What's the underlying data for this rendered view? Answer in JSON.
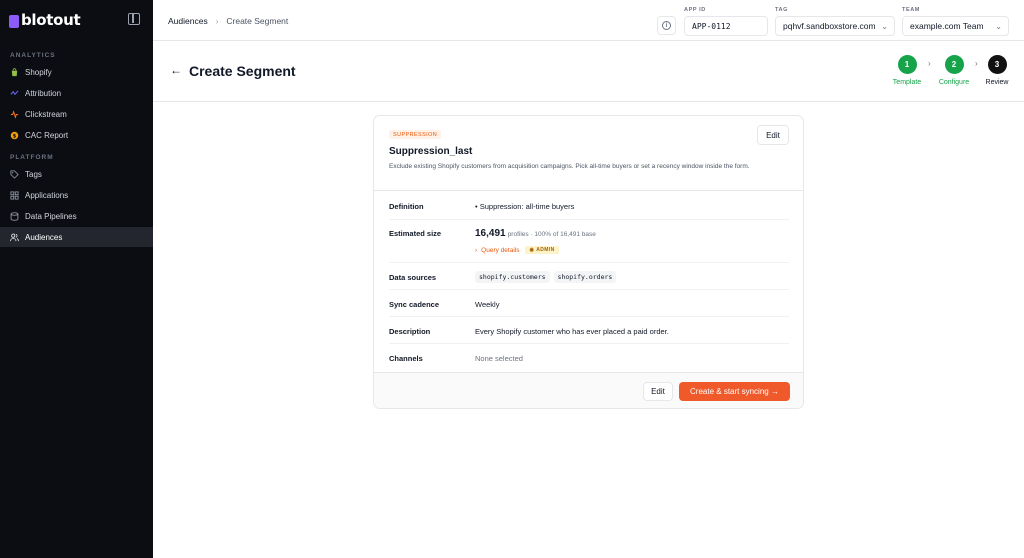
{
  "brand": {
    "name": "blotout"
  },
  "sidebar": {
    "sections": [
      {
        "label": "ANALYTICS"
      },
      {
        "label": "PLATFORM"
      }
    ],
    "items": [
      {
        "label": "Shopify",
        "icon": "shopify-bag-icon"
      },
      {
        "label": "Attribution",
        "icon": "attribution-icon"
      },
      {
        "label": "Clickstream",
        "icon": "clickstream-icon"
      },
      {
        "label": "CAC Report",
        "icon": "dollar-circle-icon"
      },
      {
        "label": "Tags",
        "icon": "tag-icon"
      },
      {
        "label": "Applications",
        "icon": "applications-icon"
      },
      {
        "label": "Data Pipelines",
        "icon": "database-icon"
      },
      {
        "label": "Audiences",
        "icon": "users-icon",
        "active": true
      }
    ]
  },
  "topbar": {
    "breadcrumb": [
      "Audiences",
      "Create Segment"
    ],
    "app_id": {
      "label": "APP ID",
      "value": "APP-0112"
    },
    "tag": {
      "label": "TAG",
      "value": "pqhvf.sandboxstore.com"
    },
    "team": {
      "label": "TEAM",
      "value": "example.com Team"
    }
  },
  "page": {
    "title": "Create Segment",
    "steps": [
      {
        "num": "1",
        "label": "Template",
        "state": "done"
      },
      {
        "num": "2",
        "label": "Configure",
        "state": "done"
      },
      {
        "num": "3",
        "label": "Review",
        "state": "current"
      }
    ]
  },
  "card": {
    "badge": "SUPPRESSION",
    "edit_label": "Edit",
    "title": "Suppression_last",
    "description": "Exclude existing Shopify customers from acquisition campaigns. Pick all-time buyers or set a recency window inside the form.",
    "definition": {
      "label": "Definition",
      "value": "Suppression: all-time buyers"
    },
    "size": {
      "label": "Estimated size",
      "count": "16,491",
      "detail": "profiles · 100% of 16,491 base",
      "query_link": "Query details",
      "admin_badge": "ADMIN"
    },
    "sources": {
      "label": "Data sources",
      "chips": [
        "shopify.customers",
        "shopify.orders"
      ]
    },
    "sync": {
      "label": "Sync cadence",
      "value": "Weekly"
    },
    "description_row": {
      "label": "Description",
      "value": "Every Shopify customer who has ever placed a paid order."
    },
    "channels": {
      "label": "Channels",
      "value": "None selected"
    },
    "footer": {
      "edit_label": "Edit",
      "primary_label": "Create & start syncing →"
    }
  },
  "colors": {
    "accent": "#f0592a",
    "success": "#16a34a",
    "sidebar_bg": "#0b0d12"
  }
}
